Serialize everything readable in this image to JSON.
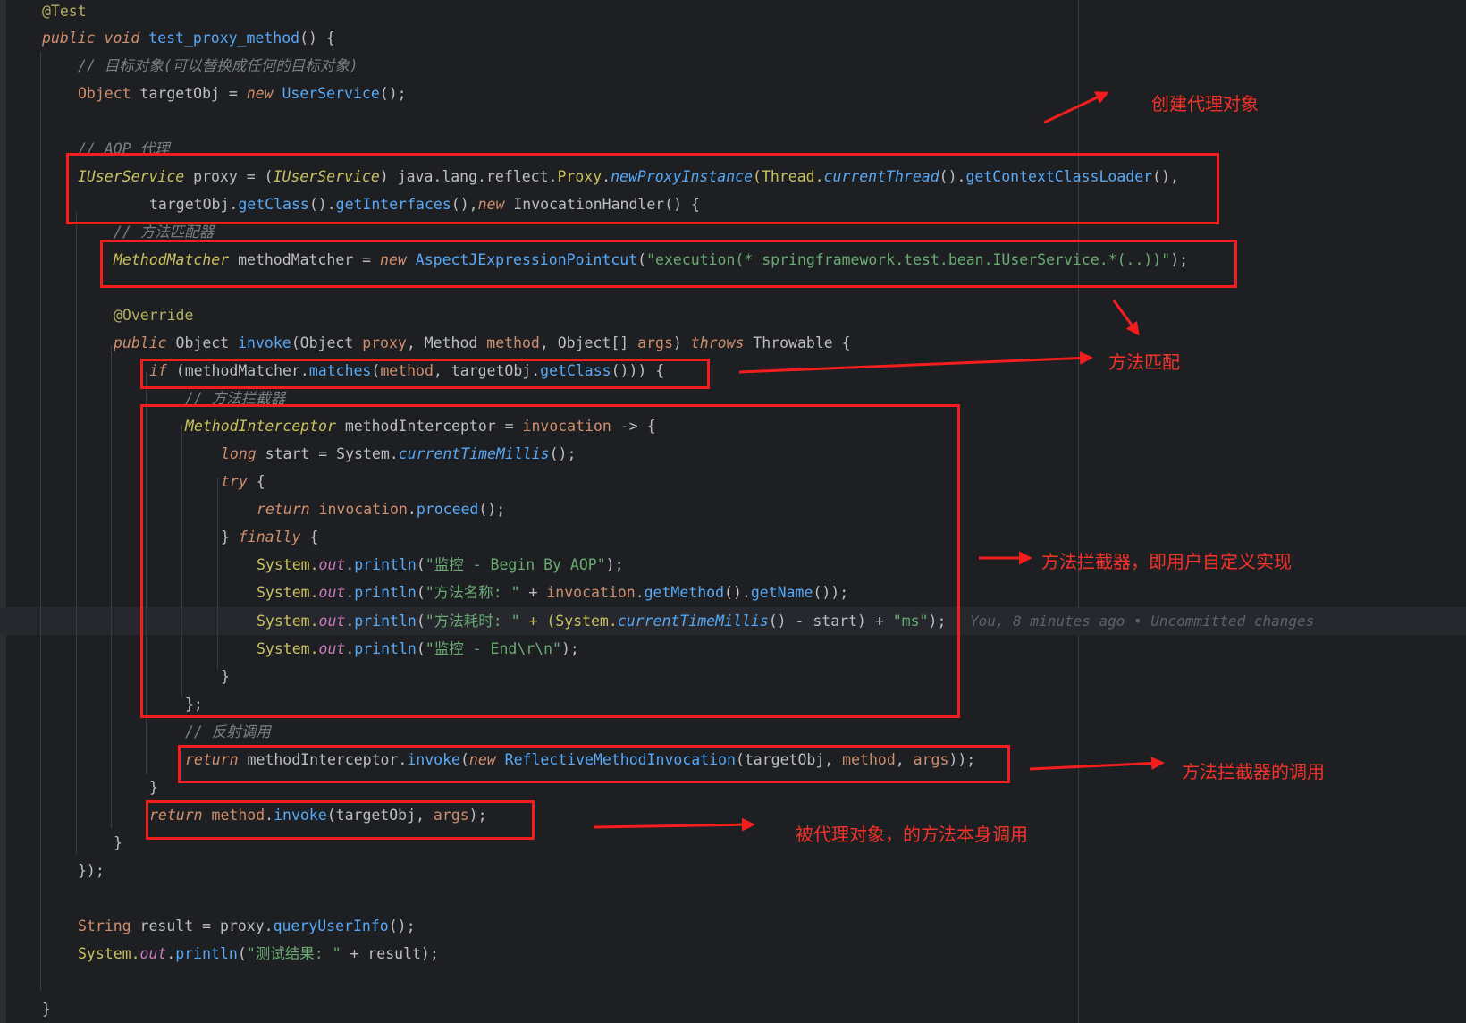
{
  "code": {
    "line_1": "@Test",
    "line_2a": "public",
    "line_2b": "void",
    "line_2c": "test_proxy_method",
    "line_2d": "() {",
    "line_3": "// 目标对象(可以替换成任何的目标对象)",
    "line_4a": "Object",
    "line_4b": " targetObj = ",
    "line_4c": "new",
    "line_4d": "UserService",
    "line_4e": "();",
    "line_6": "// AOP 代理",
    "line_7a": "IUserService",
    "line_7b": " proxy = (",
    "line_7c": "IUserService",
    "line_7d": ") java.lang.reflect.",
    "line_7e": "Proxy",
    "line_7f": ".",
    "line_7g": "newProxyInstance",
    "line_7h": "(Thread.",
    "line_7i": "currentThread",
    "line_7j": "().",
    "line_7k": "getContextClassLoader",
    "line_7l": "(),",
    "line_8a": "targetObj.",
    "line_8b": "getClass",
    "line_8c": "().",
    "line_8d": "getInterfaces",
    "line_8e": "(),",
    "line_8f": "new",
    "line_8g": " InvocationHandler() {",
    "line_9": "// 方法匹配器",
    "line_10a": "MethodMatcher",
    "line_10b": " methodMatcher = ",
    "line_10c": "new",
    "line_10d": "AspectJExpressionPointcut",
    "line_10e": "(",
    "line_10f": "\"execution(* springframework.test.bean.IUserService.*(..))\"",
    "line_10g": ");",
    "line_12": "@Override",
    "line_13a": "public",
    "line_13b": " Object ",
    "line_13c": "invoke",
    "line_13d": "(Object ",
    "line_13e": "proxy",
    "line_13f": ", Method ",
    "line_13g": "method",
    "line_13h": ", Object[] ",
    "line_13i": "args",
    "line_13j": ") ",
    "line_13k": "throws",
    "line_13l": " Throwable {",
    "line_14a": "if",
    "line_14b": " (methodMatcher.",
    "line_14c": "matches",
    "line_14d": "(",
    "line_14e": "method",
    "line_14f": ", targetObj.",
    "line_14g": "getClass",
    "line_14h": "())) {",
    "line_15": "// 方法拦截器",
    "line_16a": "MethodInterceptor",
    "line_16b": " methodInterceptor = ",
    "line_16c": "invocation",
    "line_16d": " -> {",
    "line_17a": "long",
    "line_17b": " start = System.",
    "line_17c": "currentTimeMillis",
    "line_17d": "();",
    "line_18a": "try",
    "line_18b": " {",
    "line_19a": "return",
    "line_19b": "invocation",
    "line_19c": ".",
    "line_19d": "proceed",
    "line_19e": "();",
    "line_20a": "} ",
    "line_20b": "finally",
    "line_20c": " {",
    "line_21a": "System.",
    "line_21b": "out",
    "line_21c": ".",
    "line_21d": "println",
    "line_21e": "(",
    "line_21f": "\"监控 - Begin By AOP\"",
    "line_21g": ");",
    "line_22f": "\"方法名称: \"",
    "line_22g": " + ",
    "line_22h": "invocation",
    "line_22i": ".",
    "line_22j": "getMethod",
    "line_22k": "().",
    "line_22l": "getName",
    "line_22m": "());",
    "line_23f": "\"方法耗时: \"",
    "line_23g": " + (System.",
    "line_23h": "currentTimeMillis",
    "line_23i": "() - start) + ",
    "line_23j": "\"ms\"",
    "line_23k": ");",
    "line_24f": "\"监控 - End\\r\\n\"",
    "line_24g": ");",
    "line_25": "}",
    "line_26": "};",
    "line_27": "// 反射调用",
    "line_28a": "return",
    "line_28b": " methodInterceptor.",
    "line_28c": "invoke",
    "line_28d": "(",
    "line_28e": "new",
    "line_28f": "ReflectiveMethodInvocation",
    "line_28g": "(targetObj, ",
    "line_28h": "method",
    "line_28i": ", ",
    "line_28j": "args",
    "line_28k": "));",
    "line_29": "}",
    "line_30a": "return",
    "line_30b": "method",
    "line_30c": ".",
    "line_30d": "invoke",
    "line_30e": "(targetObj, ",
    "line_30f": "args",
    "line_30g": ");",
    "line_31": "}",
    "line_32": "});",
    "line_34a": "String",
    "line_34b": " result = proxy.",
    "line_34c": "queryUserInfo",
    "line_34d": "();",
    "line_35a": "System.",
    "line_35b": "out",
    "line_35c": ".",
    "line_35d": "println",
    "line_35e": "(",
    "line_35f": "\"测试结果: \"",
    "line_35g": " + result);",
    "line_37": "}"
  },
  "blame": "You, 8 minutes ago • Uncommitted changes",
  "annotations": {
    "create_proxy": "创建代理对象",
    "method_match": "方法匹配",
    "interceptor": "方法拦截器，即用户自定义实现",
    "interceptor_call": "方法拦截器的调用",
    "self_call": "被代理对象，的方法本身调用"
  },
  "colors": {
    "background": "#1e1f22",
    "annotation_red": "#f21d1d",
    "keyword": "#cf8e6d",
    "string": "#6aab73",
    "method_call": "#56a8f5",
    "comment": "#7a7e85"
  }
}
